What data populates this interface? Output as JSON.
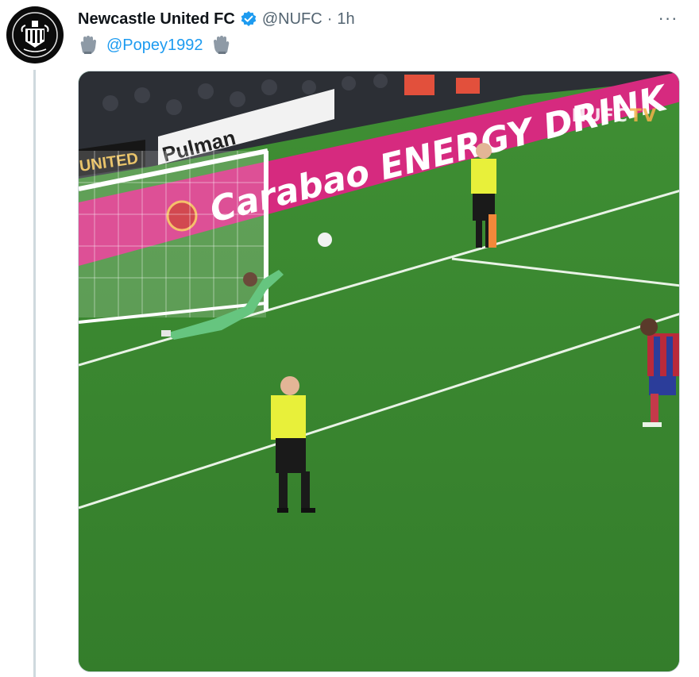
{
  "author": {
    "display_name": "Newcastle United FC",
    "handle": "@NUFC",
    "separator": "·",
    "time": "1h",
    "verified": true,
    "avatar_icon": "nufc-crest-icon"
  },
  "tweet": {
    "mention": "@Popey1992",
    "leading_emoji": "goalkeeper-glove-icon",
    "trailing_emoji": "goalkeeper-glove-icon"
  },
  "more_menu": {
    "label": "···"
  },
  "media": {
    "type": "video-frame",
    "watermark": "NUFC",
    "watermark_suffix": "TV",
    "boards": {
      "main": "Carabao ENERGY DRINK",
      "small": "Pulman",
      "side": "UNITED"
    }
  },
  "colors": {
    "accent": "#1d9bf0",
    "pitch": "#3c8a30",
    "board": "#d62a7f"
  }
}
